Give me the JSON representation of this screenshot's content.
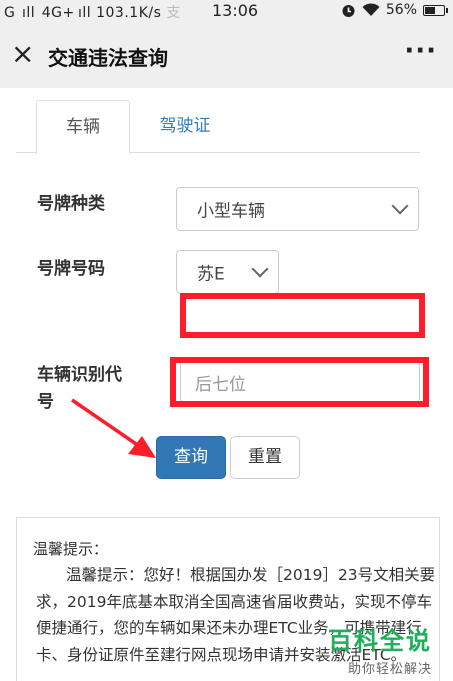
{
  "status_bar": {
    "signal_left": "G  ıll  4G+ ıll",
    "network_speed": "103.1K/s",
    "notification_glyph": "支",
    "time": "13:06",
    "battery": "56%",
    "battery_level": 0.56
  },
  "header": {
    "close_icon": "×",
    "title": "交通违法查询",
    "more_icon": "···"
  },
  "tabs": [
    {
      "label": "车辆"
    },
    {
      "label": "驾驶证"
    }
  ],
  "form": {
    "plate_type_label": "号牌种类",
    "plate_type_value": "小型车辆",
    "plate_number_label": "号牌号码",
    "plate_prefix_value": "苏E",
    "plate_number_value": "",
    "vin_label_line1": "车辆识别代",
    "vin_label_line2": "号",
    "vin_placeholder": "后七位"
  },
  "buttons": {
    "query": "查询",
    "reset": "重置"
  },
  "tips": {
    "title": "温馨提示：",
    "body": "温馨提示：您好！根据国办发［2019］23号文相关要求，2019年底基本取消全国高速省届收费站，实现不停车便捷通行，您的车辆如果还未办理ETC业务，可携带建行卡、身份证原件至建行网点现场申请并安装激活ETC。"
  },
  "watermark": {
    "brand": "百科全说",
    "slogan": "助你轻松解决"
  },
  "colors": {
    "primary": "#3277b6",
    "link": "#2f7dc1",
    "highlight_frame": "#ff1c2b",
    "watermark": "#1fae5b"
  }
}
